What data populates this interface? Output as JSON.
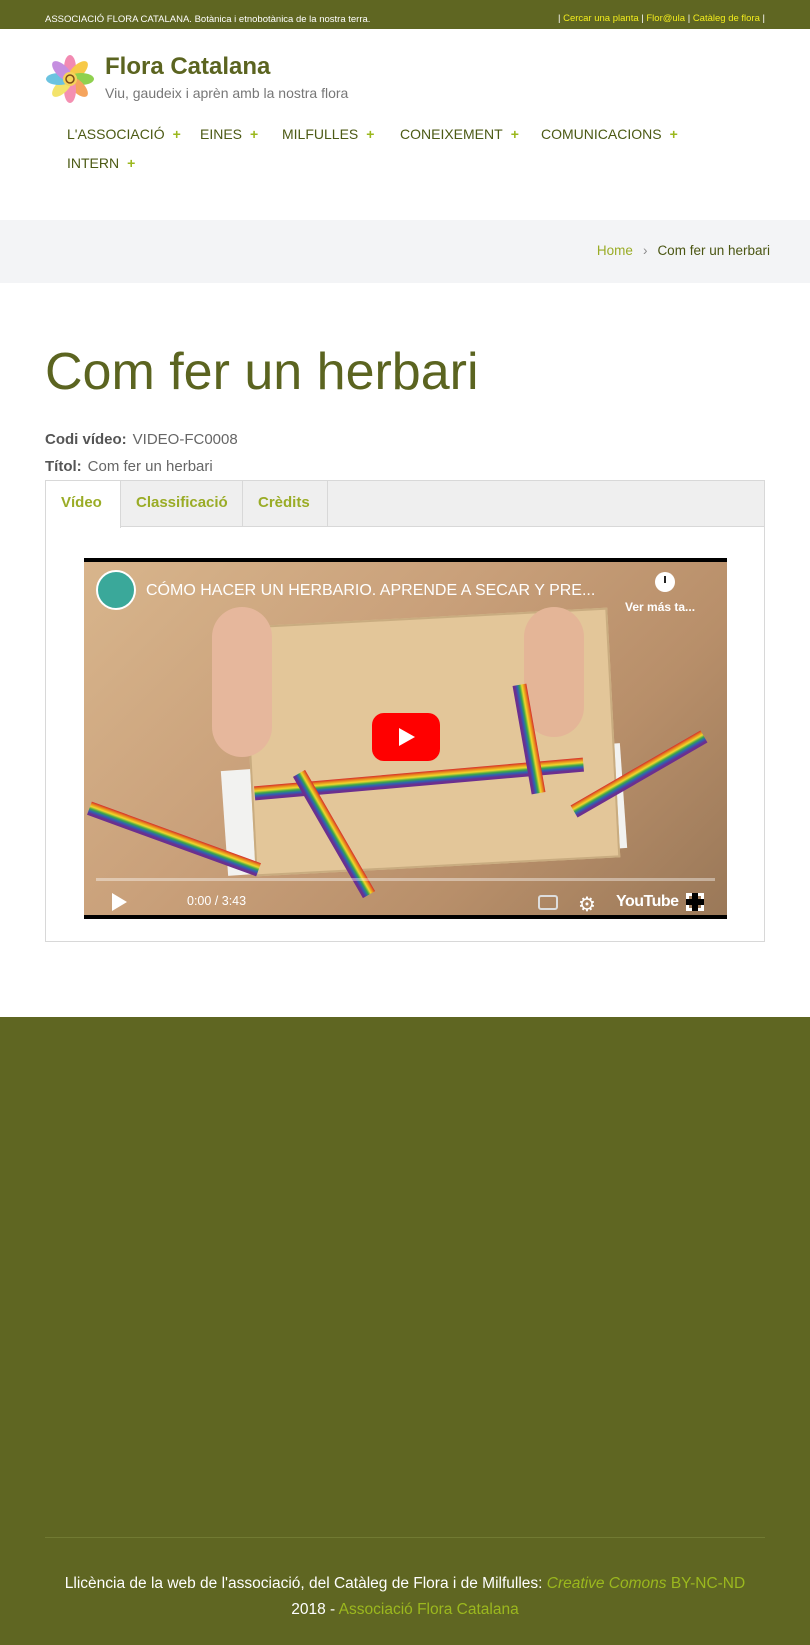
{
  "topbar": {
    "left_text": "ASSOCIACIÓ FLORA CATALANA. Botànica i etnobotànica de la nostra terra.",
    "links": [
      "Cercar una planta",
      "Flor@ula",
      "Catàleg de flora"
    ],
    "sep": "|"
  },
  "header": {
    "logo_icon": "flower-at-icon",
    "title": "Flora Catalana",
    "tagline": "Viu, gaudeix i aprèn amb la nostra flora",
    "nav": [
      {
        "label": "L'ASSOCIACIÓ",
        "icon": "plus-icon"
      },
      {
        "label": "EINES",
        "icon": "plus-icon"
      },
      {
        "label": "MILFULLES",
        "icon": "plus-icon"
      },
      {
        "label": "CONEIXEMENT",
        "icon": "plus-icon"
      },
      {
        "label": "COMUNICACIONS",
        "icon": "plus-icon"
      },
      {
        "label": "INTERN",
        "icon": "plus-icon"
      }
    ],
    "plus": "+"
  },
  "breadcrumb": {
    "home": "Home",
    "separator": "›",
    "current": "Com fer un herbari"
  },
  "main": {
    "title": "Com fer un herbari",
    "fields": [
      {
        "label": "Codi vídeo:",
        "value": "VIDEO-FC0008"
      },
      {
        "label": "Títol:",
        "value": "Com fer un herbari"
      }
    ],
    "tabs": [
      {
        "label": "Vídeo",
        "active": true
      },
      {
        "label": "Classificació",
        "active": false
      },
      {
        "label": "Crèdits",
        "active": false
      }
    ]
  },
  "video": {
    "title": "CÓMO HACER UN HERBARIO. APRENDE A SECAR Y PRE...",
    "watch_later": "Ver más ta...",
    "time": "0:00 / 3:43",
    "brand": "YouTube",
    "progress": 0
  },
  "footer": {
    "text_before": "Llicència de la web de l'associació, del Catàleg de Flora i de Milfulles:",
    "cc": "Creative Comons",
    "license": "BY-NC-ND",
    "year": "2018 -",
    "org": "Associació Flora Catalana"
  },
  "colors": {
    "brand_green": "#5f6622",
    "accent": "#9bb81e",
    "topbar_link": "#f2ec1c",
    "youtube_red": "#ff0000"
  }
}
